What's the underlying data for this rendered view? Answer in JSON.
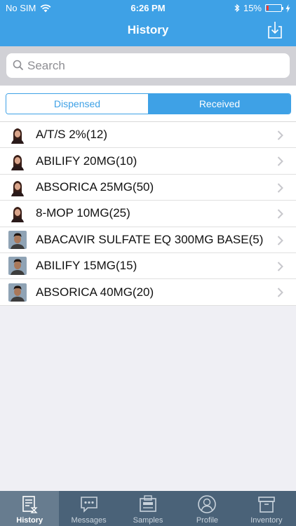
{
  "status_bar": {
    "carrier": "No SIM",
    "time": "6:26 PM",
    "battery": "15%",
    "battery_level": 0.15
  },
  "header": {
    "title": "History"
  },
  "search": {
    "placeholder": "Search",
    "value": ""
  },
  "segments": {
    "items": [
      {
        "label": "Dispensed",
        "active": false
      },
      {
        "label": "Received",
        "active": true
      }
    ]
  },
  "list": {
    "items": [
      {
        "label": "A/T/S 2%(12)",
        "avatar": "female"
      },
      {
        "label": "ABILIFY 20MG(10)",
        "avatar": "female"
      },
      {
        "label": "ABSORICA 25MG(50)",
        "avatar": "female"
      },
      {
        "label": "8-MOP 10MG(25)",
        "avatar": "female"
      },
      {
        "label": "ABACAVIR SULFATE EQ 300MG BASE(5)",
        "avatar": "male"
      },
      {
        "label": "ABILIFY 15MG(15)",
        "avatar": "male"
      },
      {
        "label": "ABSORICA 40MG(20)",
        "avatar": "male"
      }
    ]
  },
  "tabbar": {
    "items": [
      {
        "label": "History",
        "icon": "history-icon",
        "active": true
      },
      {
        "label": "Messages",
        "icon": "messages-icon",
        "active": false
      },
      {
        "label": "Samples",
        "icon": "samples-icon",
        "active": false
      },
      {
        "label": "Profile",
        "icon": "profile-icon",
        "active": false
      },
      {
        "label": "Inventory",
        "icon": "inventory-icon",
        "active": false
      }
    ]
  },
  "colors": {
    "accent": "#3ea1e6",
    "tabbar": "#4a6278",
    "tab_active": "#677c8f",
    "battery_low": "#ff3b30"
  }
}
